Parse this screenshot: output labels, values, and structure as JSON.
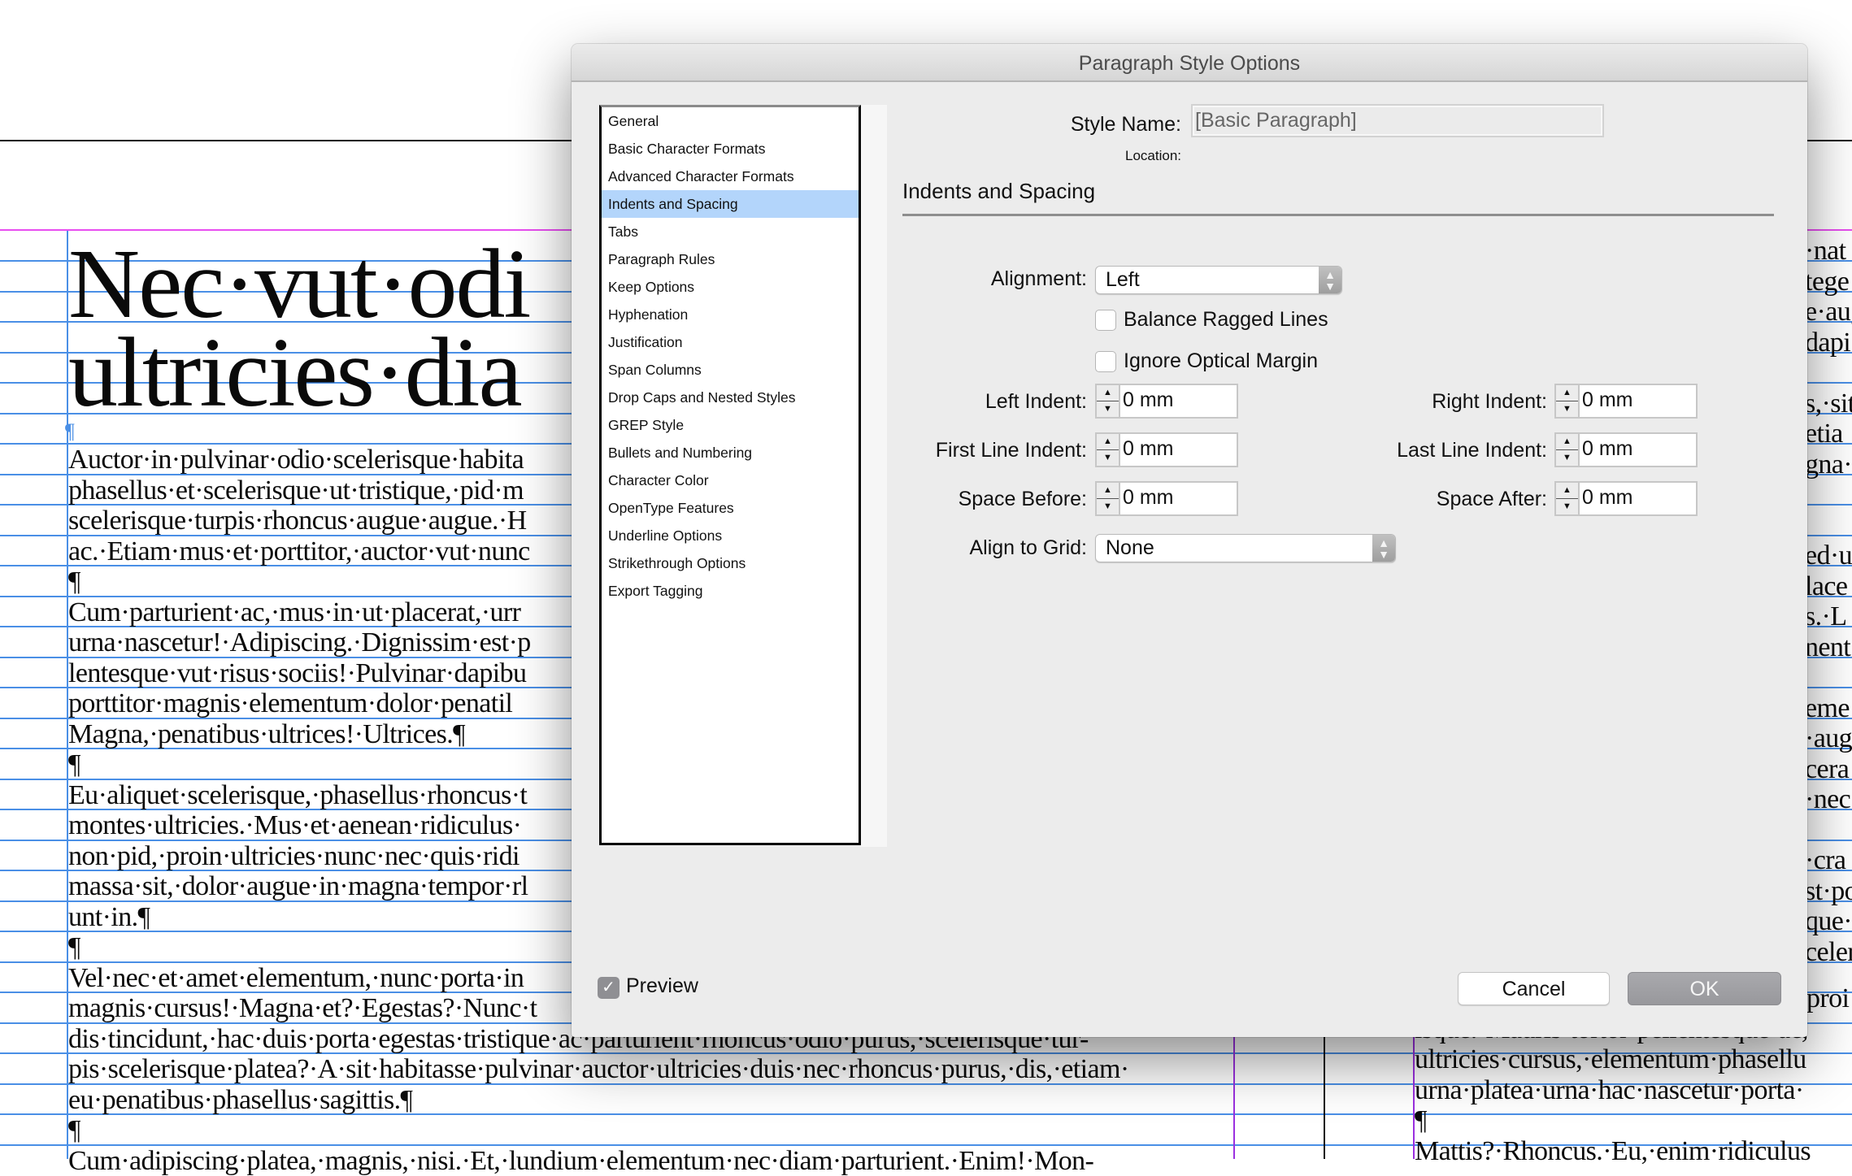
{
  "document": {
    "headline_lines": [
      "Nec·vut·odi",
      "ultricies·dia"
    ],
    "left_column_lines": [
      "Auctor·in·pulvinar·odio·scelerisque·habita",
      "phasellus·et·scelerisque·ut·tristique,·pid·m",
      "scelerisque·turpis·rhoncus·augue·augue.·H",
      "ac.·Etiam·mus·et·porttitor,·auctor·vut·nunc",
      "¶",
      "Cum·parturient·ac,·mus·in·ut·placerat,·urr",
      "urna·nascetur!·Adipiscing.·Dignissim·est·p",
      "lentesque·vut·risus·sociis!·Pulvinar·dapibu",
      "porttitor·magnis·elementum·dolor·penatil",
      "Magna,·penatibus·ultrices!·Ultrices.¶",
      "¶",
      "Eu·aliquet·scelerisque,·phasellus·rhoncus·t",
      "montes·ultricies.·Mus·et·aenean·ridiculus·",
      "non·pid,·proin·ultricies·nunc·nec·quis·ridi",
      "massa·sit,·dolor·augue·in·magna·tempor·rl",
      "unt·in.¶",
      "¶",
      "Vel·nec·et·amet·elementum,·nunc·porta·in",
      "magnis·cursus!·Magna·et?·Egestas?·Nunc·t",
      "dis·tincidunt,·hac·duis·porta·egestas·tristique·ac·parturient·rhoncus·odio·purus,·scelerisque·tur-",
      "pis·scelerisque·platea?·A·sit·habitasse·pulvinar·auctor·ultricies·duis·nec·rhoncus·purus,·dis,·etiam·",
      "eu·penatibus·phasellus·sagittis.¶",
      "¶",
      "Cum·adipiscing·platea,·magnis,·nisi.·Et,·lundium·elementum·nec·diam·parturient.·Enim!·Mon-"
    ],
    "right_column_fragments": [
      "·nat",
      "tege",
      "e·aug",
      "dapi",
      "",
      "s,·sit",
      "etia",
      "gna·",
      "",
      "",
      "ed·u",
      "lace",
      "s.·L",
      "nent",
      "",
      "eme",
      "·aug",
      "cera",
      "·nec",
      "",
      "·cra",
      "st·po",
      "que·a",
      "celer"
    ],
    "right_column_bottom_lines": [
      "proi",
      "isque.·Mauris·tortor·pellentesque·ac,",
      "ultricies·cursus,·elementum·phasellu",
      "urna·platea·urna·hac·nascetur·porta·",
      "¶",
      "Mattis?·Rhoncus.·Eu,·enim·ridiculus"
    ],
    "colors": {
      "baseline_grid": "#4a8fe6",
      "margin_guide": "#e84ef0",
      "column_guide": "#9b30e0"
    }
  },
  "dialog": {
    "title": "Paragraph Style Options",
    "categories": [
      {
        "label": "General",
        "selected": false
      },
      {
        "label": "Basic Character Formats",
        "selected": false
      },
      {
        "label": "Advanced Character Formats",
        "selected": false
      },
      {
        "label": "Indents and Spacing",
        "selected": true
      },
      {
        "label": "Tabs",
        "selected": false
      },
      {
        "label": "Paragraph Rules",
        "selected": false
      },
      {
        "label": "Keep Options",
        "selected": false
      },
      {
        "label": "Hyphenation",
        "selected": false
      },
      {
        "label": "Justification",
        "selected": false
      },
      {
        "label": "Span Columns",
        "selected": false
      },
      {
        "label": "Drop Caps and Nested Styles",
        "selected": false
      },
      {
        "label": "GREP Style",
        "selected": false
      },
      {
        "label": "Bullets and Numbering",
        "selected": false
      },
      {
        "label": "Character Color",
        "selected": false
      },
      {
        "label": "OpenType Features",
        "selected": false
      },
      {
        "label": "Underline Options",
        "selected": false
      },
      {
        "label": "Strikethrough Options",
        "selected": false
      },
      {
        "label": "Export Tagging",
        "selected": false
      }
    ],
    "style_name_label": "Style Name:",
    "style_name_value": "[Basic Paragraph]",
    "location_label": "Location:",
    "section_title": "Indents and Spacing",
    "alignment": {
      "label": "Alignment:",
      "value": "Left"
    },
    "balance_ragged_lines": {
      "label": "Balance Ragged Lines",
      "checked": false
    },
    "ignore_optical_margin": {
      "label": "Ignore Optical Margin",
      "checked": false
    },
    "left_indent": {
      "label": "Left Indent:",
      "value": "0 mm"
    },
    "right_indent": {
      "label": "Right Indent:",
      "value": "0 mm"
    },
    "first_line_indent": {
      "label": "First Line Indent:",
      "value": "0 mm"
    },
    "last_line_indent": {
      "label": "Last Line Indent:",
      "value": "0 mm"
    },
    "space_before": {
      "label": "Space Before:",
      "value": "0 mm"
    },
    "space_after": {
      "label": "Space After:",
      "value": "0 mm"
    },
    "align_to_grid": {
      "label": "Align to Grid:",
      "value": "None"
    },
    "preview": {
      "label": "Preview",
      "checked": true
    },
    "cancel_label": "Cancel",
    "ok_label": "OK",
    "icons": {
      "spin_up": "▲",
      "spin_down": "▼",
      "select_arrows": "⌃⌄",
      "check": "✓"
    },
    "colors": {
      "selection": "#b3d5fb",
      "ok_button": "#a1a1a5"
    }
  }
}
